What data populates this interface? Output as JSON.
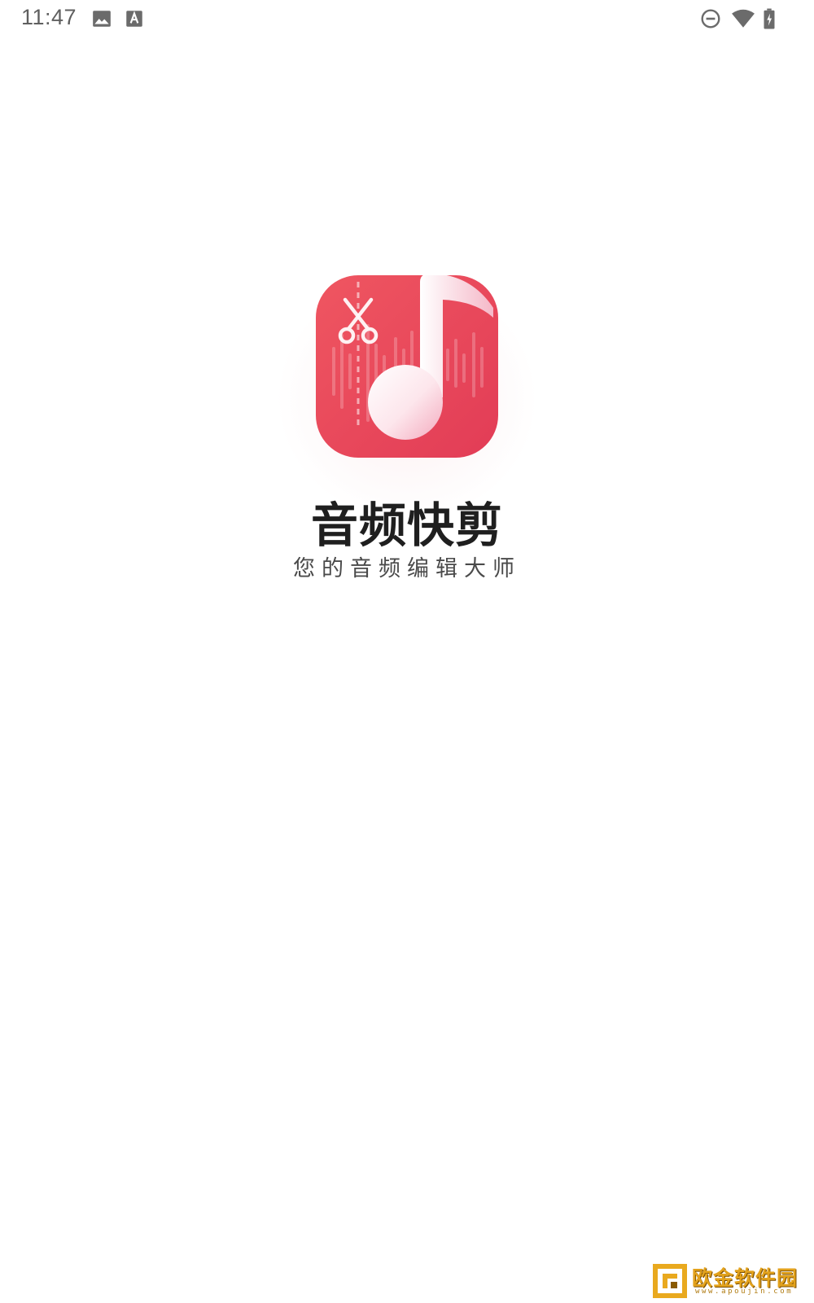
{
  "status_bar": {
    "time": "11:47",
    "left_icons": [
      "image-icon",
      "text-a-icon"
    ],
    "right_icons": [
      "do-not-disturb-icon",
      "wifi-icon",
      "battery-charging-icon"
    ]
  },
  "splash": {
    "app_name": "音频快剪",
    "slogan": "您的音频编辑大师",
    "icon": "music-note-scissors-icon",
    "accent_color": "#e8475b"
  },
  "watermark": {
    "site_name": "欧金软件园",
    "url": "www.apoujin.com",
    "color": "#e3a21c"
  }
}
